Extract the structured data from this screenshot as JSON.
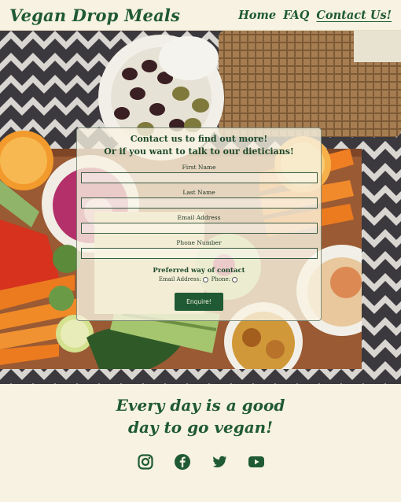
{
  "header": {
    "brand": "Vegan Drop Meals",
    "nav": [
      {
        "label": "Home",
        "active": false
      },
      {
        "label": "FAQ",
        "active": false
      },
      {
        "label": "Contact Us!",
        "active": true
      }
    ]
  },
  "contact_form": {
    "title_line1": "Contact us to find out more!",
    "title_line2": "Or if you want to talk to our dieticians!",
    "fields": [
      {
        "label": "First Name",
        "value": ""
      },
      {
        "label": "Last Name",
        "value": ""
      },
      {
        "label": "Email Address",
        "value": ""
      },
      {
        "label": "Phone Number",
        "value": ""
      }
    ],
    "preferred_contact_title": "Preferred way of contact",
    "options": [
      "Email Address:",
      "Phone:"
    ],
    "submit_label": "Enquire!"
  },
  "footer": {
    "tagline_line1": "Every day is a good",
    "tagline_line2": "day to go vegan!",
    "social_icons": [
      "instagram-icon",
      "facebook-icon",
      "twitter-icon",
      "youtube-icon"
    ]
  },
  "colors": {
    "brand_green": "#1f5a34",
    "cream": "#f7f2e1"
  }
}
